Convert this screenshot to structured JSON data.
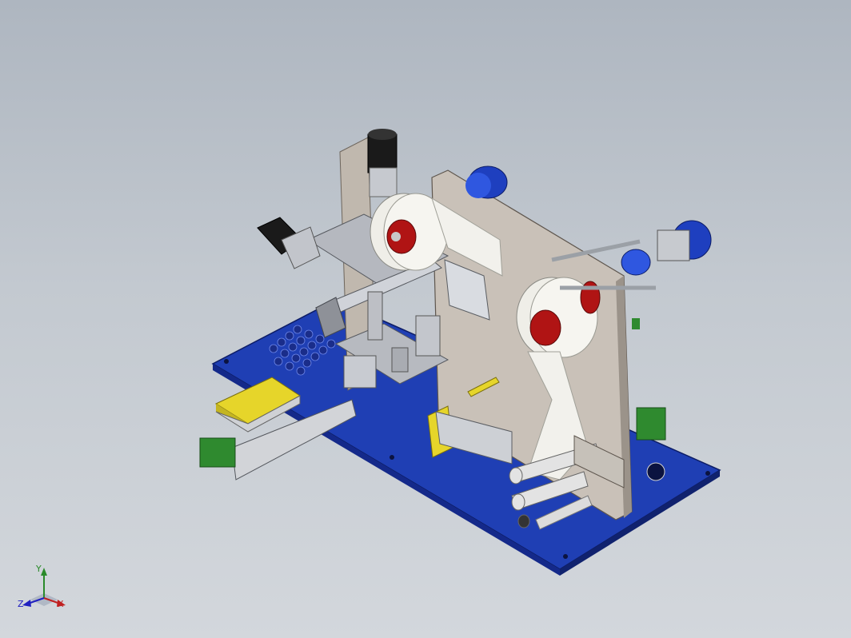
{
  "viewport": {
    "background_top": "#aeb6c0",
    "background_bottom": "#d3d7dc"
  },
  "model": {
    "baseplate_color": "#1f3fb4",
    "frame_color": "#c9c1b8",
    "roller_color": "#efeee8",
    "hub_color": "#b01414",
    "motor_color": "#1e3fbf",
    "servo_color": "#1a1a1a",
    "tray_color": "#e6d52a",
    "connector_color": "#2f8a2f"
  },
  "triad": {
    "x_label": "X",
    "y_label": "Y",
    "z_label": "Z",
    "icon": "coordinate-triad-icon"
  }
}
